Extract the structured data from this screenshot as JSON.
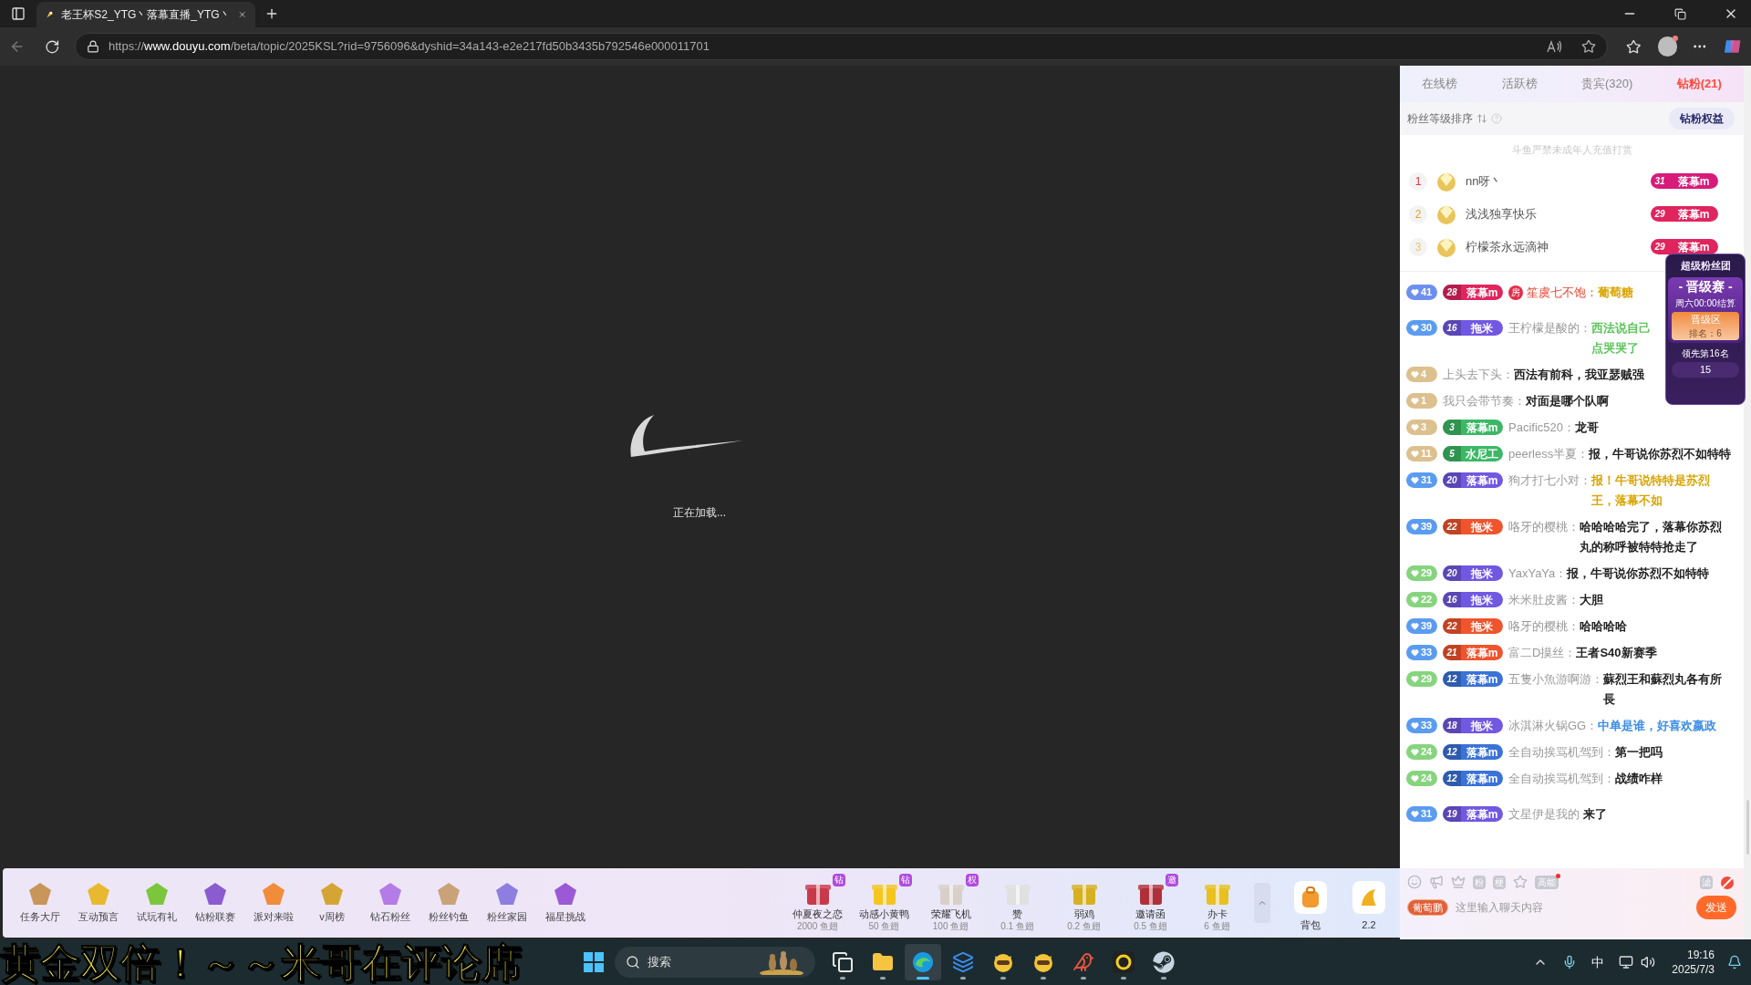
{
  "browser": {
    "tab_title": "老王杯S2_YTG丶落幕直播_YTG丶",
    "url_scheme": "https://",
    "url_host": "www.douyu.com",
    "url_path": "/beta/topic/2025KSL?rid=9756096&dyshid=34a143-e2e217fd50b3435b792546e000011701"
  },
  "player": {
    "loading_text": "正在加载..."
  },
  "panel": {
    "tabs": [
      {
        "label": "在线榜",
        "selected": false
      },
      {
        "label": "活跃榜",
        "selected": false
      },
      {
        "label": "贵宾(320)",
        "selected": false
      },
      {
        "label": "钻粉(21)",
        "selected": true
      }
    ],
    "sort_label": "粉丝等级排序",
    "benefits_button": "钻粉权益",
    "notice": "斗鱼严禁未成年人充值打赏",
    "ranking": [
      {
        "rank": "1",
        "name": "nn呀丶",
        "badge_level": "31",
        "badge_name": "落幕m",
        "color": "#d81b7a"
      },
      {
        "rank": "2",
        "name": "浅浅独享快乐",
        "badge_level": "29",
        "badge_name": "落幕m",
        "color": "#e0245e"
      },
      {
        "rank": "3",
        "name": "柠檬茶永远滴神",
        "badge_level": "29",
        "badge_name": "落幕m",
        "color": "#e0245e"
      }
    ],
    "super_fan": {
      "title": "超级粉丝团",
      "event": "- 晋级赛 -",
      "settle": "周六00:00结算",
      "zone": "晋级区",
      "rank": "排名：6",
      "lead": "领先第16名",
      "count": "15"
    },
    "messages": [
      {
        "fan": {
          "level": "41",
          "color": "#6f8ff0"
        },
        "badge": {
          "level": "28",
          "name": "落幕m",
          "color": "#e0245e"
        },
        "room_badge": "房",
        "user": {
          "name": "笙虞七不饱：",
          "color": "#e84a3a"
        },
        "message": {
          "text": "葡萄糖",
          "color": "#d9a400"
        }
      },
      {
        "fan": {
          "level": "30",
          "color": "#5b9cf0"
        },
        "badge": {
          "level": "16",
          "name": "拖米",
          "color": "#7158e2"
        },
        "user": {
          "name": "王柠檬是酸的：",
          "color": "#999999"
        },
        "message": {
          "text": "西法说自己点哭哭了",
          "color": "#5cc45a"
        }
      },
      {
        "fan": {
          "level": "4",
          "color": "#dcc08e"
        },
        "user": {
          "name": "上头去下头：",
          "color": "#999999"
        },
        "message": {
          "text": "西法有前科，我亚瑟贼强",
          "color": "#222222"
        }
      },
      {
        "fan": {
          "level": "1",
          "color": "#dcc08e"
        },
        "user": {
          "name": "我只会带节奏：",
          "color": "#999999"
        },
        "message": {
          "text": "对面是哪个队啊",
          "color": "#222222"
        }
      },
      {
        "fan": {
          "level": "3",
          "color": "#dcc08e"
        },
        "badge": {
          "level": "3",
          "name": "落幕m",
          "color": "#3cb865"
        },
        "user": {
          "name": "Pacific520：",
          "color": "#999999"
        },
        "message": {
          "text": "龙哥",
          "color": "#222222"
        }
      },
      {
        "fan": {
          "level": "11",
          "color": "#dcc08e"
        },
        "badge": {
          "level": "5",
          "name": "水尼工",
          "color": "#3cb865"
        },
        "user": {
          "name": "peerless半夏：",
          "color": "#999999"
        },
        "message": {
          "text": "报，牛哥说你苏烈不如特特",
          "color": "#222222"
        }
      },
      {
        "fan": {
          "level": "31",
          "color": "#5b9cf0"
        },
        "badge": {
          "level": "20",
          "name": "落幕m",
          "color": "#7158e2"
        },
        "user": {
          "name": "狗才打七小对：",
          "color": "#999999"
        },
        "message": {
          "text": "报！牛哥说特特是苏烈王，落幕不如",
          "color": "#d9a400"
        }
      },
      {
        "fan": {
          "level": "39",
          "color": "#5b9cf0"
        },
        "badge": {
          "level": "22",
          "name": "拖米",
          "color": "#f0542d"
        },
        "user": {
          "name": "咯牙的樱桃：",
          "color": "#999999"
        },
        "message": {
          "text": "哈哈哈哈完了，落幕你苏烈丸的称呼被特特抢走了",
          "color": "#222222"
        }
      },
      {
        "fan": {
          "level": "29",
          "color": "#86d47e"
        },
        "badge": {
          "level": "20",
          "name": "拖米",
          "color": "#7158e2"
        },
        "user": {
          "name": "YaxYaYa：",
          "color": "#999999"
        },
        "message": {
          "text": "报，牛哥说你苏烈不如特特",
          "color": "#222222"
        }
      },
      {
        "fan": {
          "level": "22",
          "color": "#86d47e"
        },
        "badge": {
          "level": "16",
          "name": "拖米",
          "color": "#7158e2"
        },
        "user": {
          "name": "米米肚皮酱：",
          "color": "#999999"
        },
        "message": {
          "text": "大胆",
          "color": "#222222"
        }
      },
      {
        "fan": {
          "level": "39",
          "color": "#5b9cf0"
        },
        "badge": {
          "level": "22",
          "name": "拖米",
          "color": "#f0542d"
        },
        "user": {
          "name": "咯牙的樱桃：",
          "color": "#999999"
        },
        "message": {
          "text": "哈哈哈哈",
          "color": "#222222"
        }
      },
      {
        "fan": {
          "level": "33",
          "color": "#5b9cf0"
        },
        "badge": {
          "level": "21",
          "name": "落幕m",
          "color": "#f0542d"
        },
        "user": {
          "name": "富二D摸丝：",
          "color": "#999999"
        },
        "message": {
          "text": "王者S40新赛季",
          "color": "#222222"
        }
      },
      {
        "fan": {
          "level": "29",
          "color": "#86d47e"
        },
        "badge": {
          "level": "12",
          "name": "落幕m",
          "color": "#3a72d8"
        },
        "user": {
          "name": "五隻小魚游啊游：",
          "color": "#999999"
        },
        "message": {
          "text": "蘇烈王和蘇烈丸各有所長",
          "color": "#222222"
        }
      },
      {
        "fan": {
          "level": "33",
          "color": "#5b9cf0"
        },
        "badge": {
          "level": "18",
          "name": "拖米",
          "color": "#7158e2"
        },
        "user": {
          "name": "冰淇淋火锅GG：",
          "color": "#999999"
        },
        "message": {
          "text": "中单是谁，好喜欢嬴政",
          "color": "#3d8ee6"
        }
      },
      {
        "fan": {
          "level": "24",
          "color": "#86d47e"
        },
        "badge": {
          "level": "12",
          "name": "落幕m",
          "color": "#3a72d8"
        },
        "user": {
          "name": "全自动挨骂机驾到：",
          "color": "#999999"
        },
        "message": {
          "text": "第一把吗",
          "color": "#222222"
        }
      },
      {
        "fan": {
          "level": "24",
          "color": "#86d47e"
        },
        "badge": {
          "level": "12",
          "name": "落幕m",
          "color": "#3a72d8"
        },
        "user": {
          "name": "全自动挨骂机驾到：",
          "color": "#999999"
        },
        "message": {
          "text": "战绩咋样",
          "color": "#222222"
        }
      },
      {
        "fan": {
          "level": "31",
          "color": "#5b9cf0"
        },
        "badge": {
          "level": "19",
          "name": "落幕m",
          "color": "#7158e2"
        },
        "user": {
          "name": "文星伊是我的",
          "color": "#999999"
        },
        "message": {
          "text": "来了",
          "color": "#222222"
        }
      }
    ],
    "chat_tools": [
      "粉",
      "梗",
      "高能",
      "滤"
    ],
    "input_badge": "葡萄鹏",
    "input_placeholder": "这里输入聊天内容",
    "send_button": "发送"
  },
  "activity_bar": [
    {
      "label": "任务大厅",
      "color": "#c8955a"
    },
    {
      "label": "互动预言",
      "color": "#e8b830"
    },
    {
      "label": "试玩有礼",
      "color": "#7cc63e"
    },
    {
      "label": "钻粉联赛",
      "color": "#8a5cd0"
    },
    {
      "label": "派对来啦",
      "color": "#f08c3a"
    },
    {
      "label": "v周榜",
      "color": "#d4a534"
    },
    {
      "label": "钻石粉丝",
      "color": "#b57be6"
    },
    {
      "label": "粉丝钓鱼",
      "color": "#c9a27a"
    },
    {
      "label": "粉丝家园",
      "color": "#8e7ee0"
    },
    {
      "label": "福星挑战",
      "color": "#9b59d6"
    }
  ],
  "gifts": [
    {
      "name": "仲夏夜之恋",
      "price": "2000 鱼翅",
      "tag": "钻",
      "color": "#c83a4a"
    },
    {
      "name": "动感小黄鸭",
      "price": "50 鱼翅",
      "tag": "钻",
      "color": "#f5c520"
    },
    {
      "name": "荣耀飞机",
      "price": "100 鱼翅",
      "tag": "权",
      "color": "#d8d0c8"
    },
    {
      "name": "赞",
      "price": "0.1 鱼翅",
      "color": "#e0e0e0"
    },
    {
      "name": "弱鸡",
      "price": "0.2 鱼翅",
      "color": "#d6b020"
    },
    {
      "name": "邀请函",
      "price": "0.5 鱼翅",
      "tag": "邀",
      "color": "#b0303a"
    },
    {
      "name": "办卡",
      "price": "6 鱼翅",
      "color": "#e8c020"
    }
  ],
  "backpack": "背包",
  "balance": "2.2",
  "overlay_caption": "黄金双倍！～～米哥在评论席",
  "taskbar": {
    "search_placeholder": "搜索",
    "apps": [
      {
        "kind": "taskview",
        "active": false
      },
      {
        "kind": "folder",
        "active": false
      },
      {
        "kind": "browser",
        "active": true
      },
      {
        "kind": "layers",
        "active": false
      },
      {
        "kind": "mascot",
        "active": false
      },
      {
        "kind": "mascot",
        "active": false
      },
      {
        "kind": "bird",
        "active": false
      },
      {
        "kind": "ring",
        "active": false
      },
      {
        "kind": "steam",
        "active": false
      }
    ],
    "ime": "中",
    "time": "19:16",
    "date": "2025/7/3"
  }
}
